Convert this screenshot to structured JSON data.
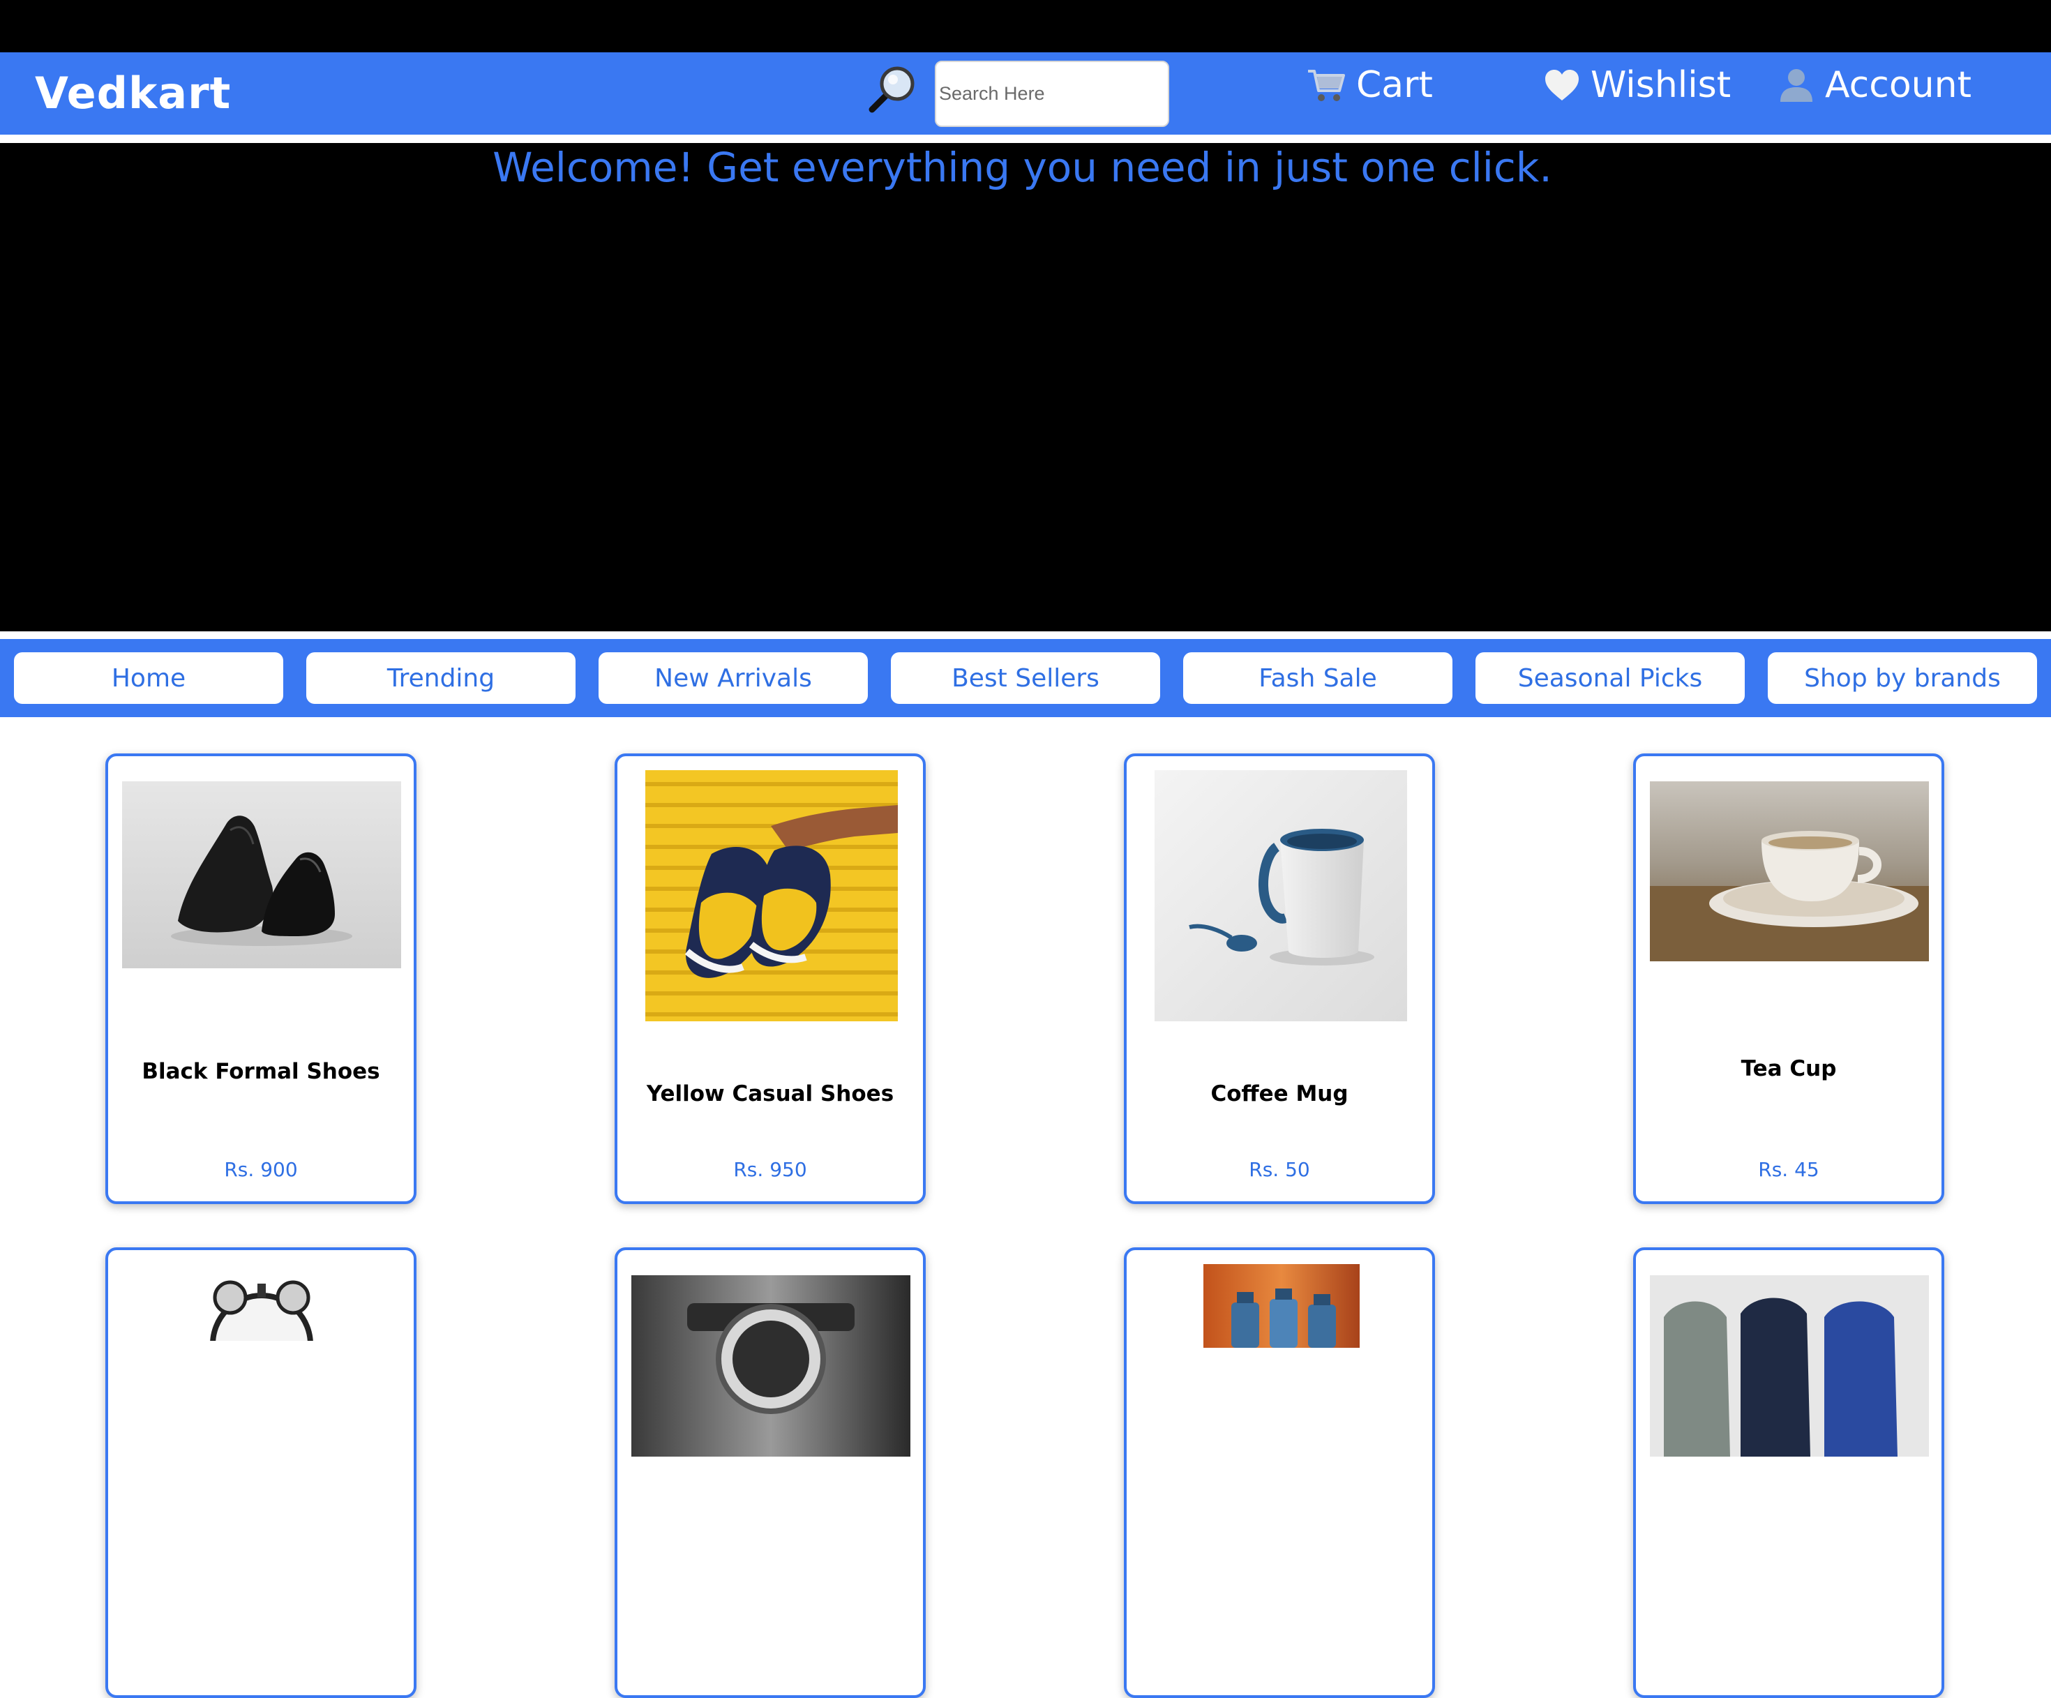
{
  "header": {
    "brand": "Vedkart",
    "search_placeholder": "Search Here",
    "links": [
      {
        "icon": "cart-icon",
        "label": "Cart"
      },
      {
        "icon": "heart-icon",
        "label": "Wishlist"
      },
      {
        "icon": "user-icon",
        "label": "Account"
      }
    ]
  },
  "hero": {
    "welcome": "Welcome! Get everything you need in just one click."
  },
  "nav": {
    "items": [
      {
        "label": "Home"
      },
      {
        "label": "Trending"
      },
      {
        "label": "New Arrivals"
      },
      {
        "label": "Best Sellers"
      },
      {
        "label": "Fash Sale"
      },
      {
        "label": "Seasonal Picks"
      },
      {
        "label": "Shop by brands"
      }
    ]
  },
  "products": [
    {
      "name": "Black Formal Shoes",
      "price": "Rs. 900",
      "image": "black-formal-shoes-image"
    },
    {
      "name": "Yellow Casual Shoes",
      "price": "Rs. 950",
      "image": "yellow-casual-shoes-image"
    },
    {
      "name": "Coffee Mug",
      "price": "Rs. 50",
      "image": "coffee-mug-image"
    },
    {
      "name": "Tea Cup",
      "price": "Rs. 45",
      "image": "tea-cup-image"
    },
    {
      "name": "",
      "price": "",
      "image": "alarm-clock-image"
    },
    {
      "name": "",
      "price": "",
      "image": "wrist-watch-image"
    },
    {
      "name": "",
      "price": "",
      "image": "water-bottles-image"
    },
    {
      "name": "",
      "price": "",
      "image": "socks-image"
    }
  ],
  "colors": {
    "brand_blue": "#3a78f2",
    "link_blue": "#2f6fe3",
    "hero_background": "#000000"
  }
}
